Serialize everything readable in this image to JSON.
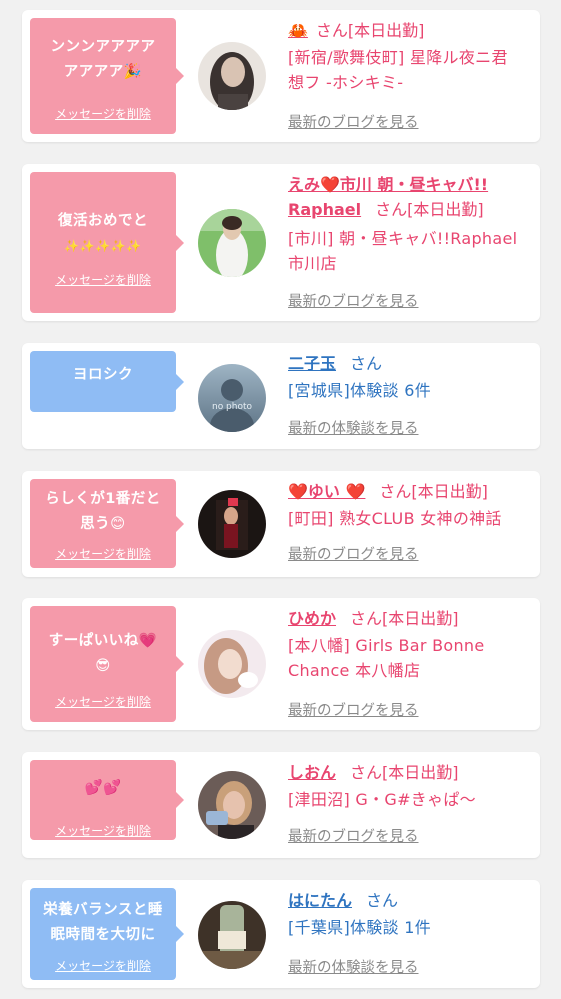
{
  "cards": [
    {
      "message_line1": "ンンンアアアア",
      "message_line2": "アアアア🎉",
      "delete_label": "メッセージを削除",
      "name": "🦀",
      "san": "さん[本日出勤]",
      "shop_line1": "[新宿/歌舞伎町] 星降ル夜ニ君",
      "shop_line2": "想フ -ホシキミ-",
      "link": "最新のブログを見る"
    },
    {
      "message_line1": "復活おめでと",
      "message_line2": "✨✨✨✨✨",
      "delete_label": "メッセージを削除",
      "name_line1": "えみ❤️市川 朝・昼キャバ!!",
      "name_line2": "Raphael",
      "san": "さん[本日出勤]",
      "shop_line1": "[市川] 朝・昼キャバ!!Raphael",
      "shop_line2": "市川店",
      "link": "最新のブログを見る"
    },
    {
      "message_line1": "ヨロシク",
      "delete_label": "メッセージを削除",
      "avatar_text": "no photo",
      "name": "二子玉",
      "san": "さん",
      "shop_line1": "[宮城県]体験談 6件",
      "link": "最新の体験談を見る"
    },
    {
      "message_line1": "らしくが1番だと",
      "message_line2": "思う😊",
      "delete_label": "メッセージを削除",
      "name": "❤️ゆい ❤️",
      "san": "さん[本日出勤]",
      "shop_line1": "[町田] 熟女CLUB 女神の神話",
      "link": "最新のブログを見る"
    },
    {
      "message_line1": "すーぱいいね💗",
      "message_line2": "😎",
      "delete_label": "メッセージを削除",
      "name": "ひめか",
      "san": "さん[本日出勤]",
      "shop_line1": "[本八幡] Girls Bar Bonne",
      "shop_line2": "Chance 本八幡店",
      "link": "最新のブログを見る"
    },
    {
      "message_line1": "💕💕",
      "delete_label": "メッセージを削除",
      "name": "しおん",
      "san": "さん[本日出勤]",
      "shop_line1": "[津田沼] G・G#きゃぱ〜",
      "link": "最新のブログを見る"
    },
    {
      "message_line1": "栄養バランスと睡",
      "message_line2": "眠時間を大切に",
      "delete_label": "メッセージを削除",
      "name": "はにたん",
      "san": "さん",
      "shop_line1": "[千葉県]体験談 1件",
      "link": "最新の体験談を見る"
    }
  ],
  "colors": {
    "pink_bubble": "#f59aaa",
    "blue_bubble": "#8fbcf4",
    "pink_text": "#e8456f",
    "blue_text": "#2f74c0",
    "gray_link": "#8a8a8a"
  }
}
